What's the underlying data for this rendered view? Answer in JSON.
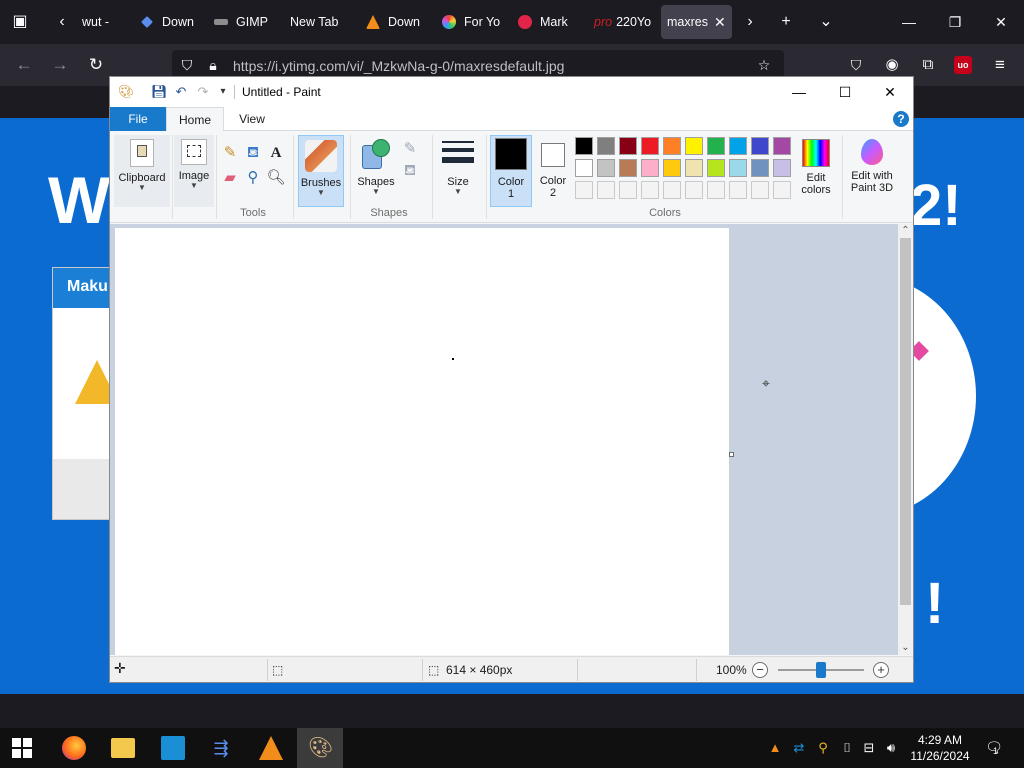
{
  "browser": {
    "tabs": [
      {
        "label": "wut -",
        "color": "#6e6e6e"
      },
      {
        "label": "Down",
        "color": "#5b8def"
      },
      {
        "label": "GIMP",
        "color": "#8d8d8d"
      },
      {
        "label": "New Tab",
        "color": ""
      },
      {
        "label": "Down",
        "color": "#f28c1b"
      },
      {
        "label": "For Yo",
        "color": "#c957d6"
      },
      {
        "label": "Mark",
        "color": "#e1254a"
      },
      {
        "label": "220Yo",
        "color": "#d01e1e",
        "prefix": "pro"
      },
      {
        "label": "maxres",
        "color": "",
        "active": true
      }
    ],
    "url": "https://i.ytimg.com/vi/_MzkwNa-g-0/maxresdefault.jpg"
  },
  "paint": {
    "title": "Untitled - Paint",
    "menu": {
      "file": "File",
      "home": "Home",
      "view": "View",
      "help": "?"
    },
    "groups": {
      "clipboard": "Clipboard",
      "image": "Image",
      "tools": "Tools",
      "brushes": "Brushes",
      "shapes_btn": "Shapes",
      "shapes": "Shapes",
      "size": "Size",
      "color1": "Color",
      "color1_num": "1",
      "color2": "Color",
      "color2_num": "2",
      "colors": "Colors",
      "edit_colors_1": "Edit",
      "edit_colors_2": "colors",
      "paint3d_1": "Edit with",
      "paint3d_2": "Paint 3D"
    },
    "palette_row1": [
      "#000000",
      "#7f7f7f",
      "#880015",
      "#ed1c24",
      "#ff7f27",
      "#fff200",
      "#22b14c",
      "#00a2e8",
      "#3f48cc",
      "#a349a4"
    ],
    "palette_row2": [
      "#ffffff",
      "#c3c3c3",
      "#b97a57",
      "#ffaec9",
      "#ffc90e",
      "#efe4b0",
      "#b5e61d",
      "#99d9ea",
      "#7092be",
      "#c8bfe7"
    ],
    "color1_value": "#000000",
    "color2_value": "#ffffff",
    "status": {
      "dimensions": "614 × 460px",
      "zoom": "100%"
    }
  },
  "taskbar": {
    "time": "4:29 AM",
    "date": "11/26/2024",
    "notifications": "1"
  }
}
